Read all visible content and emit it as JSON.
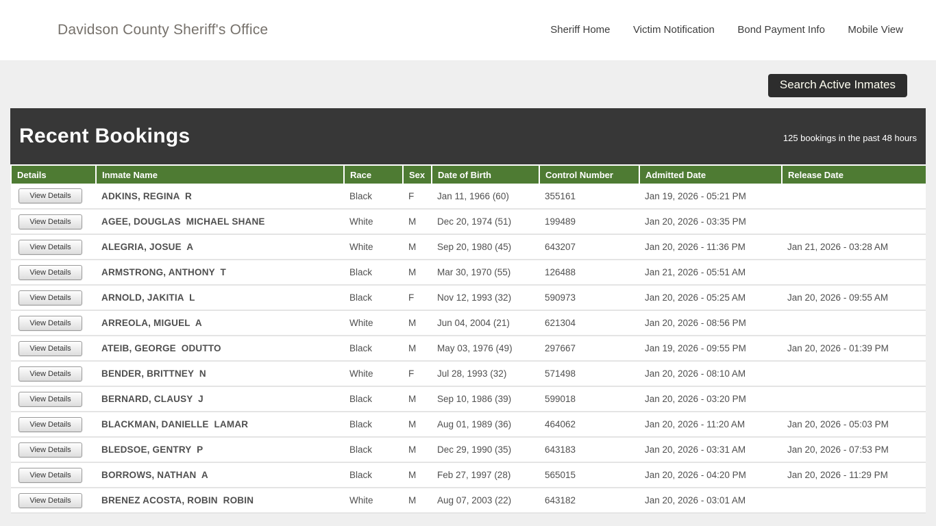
{
  "header": {
    "title": "Davidson County Sheriff's Office",
    "nav": [
      "Sheriff Home",
      "Victim Notification",
      "Bond Payment Info",
      "Mobile View"
    ]
  },
  "toolbar": {
    "search_button_label": "Search Active Inmates"
  },
  "bookings": {
    "title": "Recent Bookings",
    "subtitle": "125 bookings in the past 48 hours",
    "view_details_label": "View Details",
    "columns": [
      "Details",
      "Inmate Name",
      "Race",
      "Sex",
      "Date of Birth",
      "Control Number",
      "Admitted Date",
      "Release Date"
    ],
    "rows": [
      {
        "name": "ADKINS, REGINA  R",
        "race": "Black",
        "sex": "F",
        "dob": "Jan 11, 1966 (60)",
        "control": "355161",
        "admitted": "Jan 19, 2026 - 05:21 PM",
        "released": ""
      },
      {
        "name": "AGEE, DOUGLAS  MICHAEL SHANE",
        "race": "White",
        "sex": "M",
        "dob": "Dec 20, 1974 (51)",
        "control": "199489",
        "admitted": "Jan 20, 2026 - 03:35 PM",
        "released": ""
      },
      {
        "name": "ALEGRIA, JOSUE  A",
        "race": "White",
        "sex": "M",
        "dob": "Sep 20, 1980 (45)",
        "control": "643207",
        "admitted": "Jan 20, 2026 - 11:36 PM",
        "released": "Jan 21, 2026 - 03:28 AM"
      },
      {
        "name": "ARMSTRONG, ANTHONY  T",
        "race": "Black",
        "sex": "M",
        "dob": "Mar 30, 1970 (55)",
        "control": "126488",
        "admitted": "Jan 21, 2026 - 05:51 AM",
        "released": ""
      },
      {
        "name": "ARNOLD, JAKITIA  L",
        "race": "Black",
        "sex": "F",
        "dob": "Nov 12, 1993 (32)",
        "control": "590973",
        "admitted": "Jan 20, 2026 - 05:25 AM",
        "released": "Jan 20, 2026 - 09:55 AM"
      },
      {
        "name": "ARREOLA, MIGUEL  A",
        "race": "White",
        "sex": "M",
        "dob": "Jun 04, 2004 (21)",
        "control": "621304",
        "admitted": "Jan 20, 2026 - 08:56 PM",
        "released": ""
      },
      {
        "name": "ATEIB, GEORGE  ODUTTO",
        "race": "Black",
        "sex": "M",
        "dob": "May 03, 1976 (49)",
        "control": "297667",
        "admitted": "Jan 19, 2026 - 09:55 PM",
        "released": "Jan 20, 2026 - 01:39 PM"
      },
      {
        "name": "BENDER, BRITTNEY  N",
        "race": "White",
        "sex": "F",
        "dob": "Jul 28, 1993 (32)",
        "control": "571498",
        "admitted": "Jan 20, 2026 - 08:10 AM",
        "released": ""
      },
      {
        "name": "BERNARD, CLAUSY  J",
        "race": "Black",
        "sex": "M",
        "dob": "Sep 10, 1986 (39)",
        "control": "599018",
        "admitted": "Jan 20, 2026 - 03:20 PM",
        "released": ""
      },
      {
        "name": "BLACKMAN, DANIELLE  LAMAR",
        "race": "Black",
        "sex": "M",
        "dob": "Aug 01, 1989 (36)",
        "control": "464062",
        "admitted": "Jan 20, 2026 - 11:20 AM",
        "released": "Jan 20, 2026 - 05:03 PM"
      },
      {
        "name": "BLEDSOE, GENTRY  P",
        "race": "Black",
        "sex": "M",
        "dob": "Dec 29, 1990 (35)",
        "control": "643183",
        "admitted": "Jan 20, 2026 - 03:31 AM",
        "released": "Jan 20, 2026 - 07:53 PM"
      },
      {
        "name": "BORROWS, NATHAN  A",
        "race": "Black",
        "sex": "M",
        "dob": "Feb 27, 1997 (28)",
        "control": "565015",
        "admitted": "Jan 20, 2026 - 04:20 PM",
        "released": "Jan 20, 2026 - 11:29 PM"
      },
      {
        "name": "BRENEZ ACOSTA, ROBIN  ROBIN",
        "race": "White",
        "sex": "M",
        "dob": "Aug 07, 2003 (22)",
        "control": "643182",
        "admitted": "Jan 20, 2026 - 03:01 AM",
        "released": ""
      }
    ]
  },
  "colors": {
    "table_header_green": "#4e7b33",
    "panel_dark": "#373737",
    "page_background": "#efefef",
    "topbar_background": "#ffffff"
  }
}
